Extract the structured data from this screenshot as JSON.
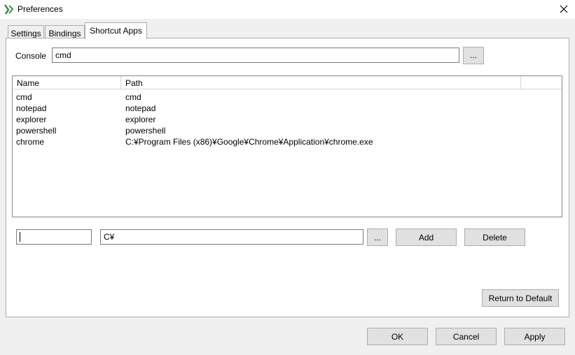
{
  "window": {
    "title": "Preferences"
  },
  "tabs": [
    {
      "label": "Settings"
    },
    {
      "label": "Bindings"
    },
    {
      "label": "Shortcut Apps"
    }
  ],
  "console": {
    "label": "Console",
    "value": "cmd",
    "browse_label": "..."
  },
  "table": {
    "columns": [
      "Name",
      "Path"
    ],
    "rows": [
      {
        "name": "cmd",
        "path": "cmd"
      },
      {
        "name": "notepad",
        "path": "notepad"
      },
      {
        "name": "explorer",
        "path": "explorer"
      },
      {
        "name": "powershell",
        "path": "powershell"
      },
      {
        "name": "chrome",
        "path": "C:¥Program Files (x86)¥Google¥Chrome¥Application¥chrome.exe"
      }
    ]
  },
  "editor": {
    "name_value": "",
    "path_value": "C¥",
    "browse_label": "...",
    "add_label": "Add",
    "delete_label": "Delete"
  },
  "return_default_label": "Return to Default",
  "footer": {
    "ok_label": "OK",
    "cancel_label": "Cancel",
    "apply_label": "Apply"
  },
  "icons": {
    "app": "app-logo-icon",
    "close": "close-icon"
  }
}
